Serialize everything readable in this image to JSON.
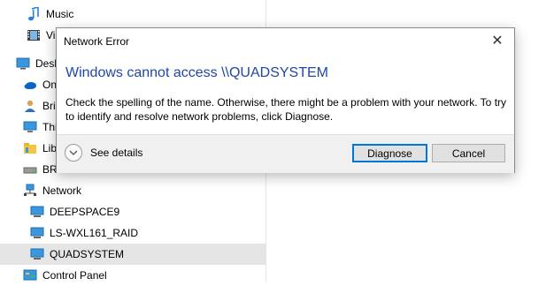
{
  "nav": {
    "items": [
      {
        "label": "Music",
        "icon": "music-note-icon"
      },
      {
        "label": "Vid",
        "icon": "videos-icon"
      },
      {
        "label": "Desk",
        "icon": "desktop-icon"
      },
      {
        "label": "On",
        "icon": "onedrive-cloud-icon"
      },
      {
        "label": "Bri",
        "icon": "user-icon"
      },
      {
        "label": "Thi",
        "icon": "this-pc-icon"
      },
      {
        "label": "Lib",
        "icon": "libraries-icon"
      },
      {
        "label": "BR",
        "icon": "drive-icon"
      },
      {
        "label": "Network",
        "icon": "network-icon"
      },
      {
        "label": "DEEPSPACE9",
        "icon": "computer-icon"
      },
      {
        "label": "LS-WXL161_RAID",
        "icon": "computer-icon"
      },
      {
        "label": "QUADSYSTEM",
        "icon": "computer-icon",
        "selected": true
      },
      {
        "label": "Control Panel",
        "icon": "control-panel-icon"
      }
    ]
  },
  "dialog": {
    "title": "Network Error",
    "heading": "Windows cannot access \\\\QUADSYSTEM",
    "message": "Check the spelling of the name. Otherwise, there might be a problem with your network. To try to identify and resolve network problems, click Diagnose.",
    "details_label": "See details",
    "diagnose_label": "Diagnose",
    "cancel_label": "Cancel",
    "close_glyph": "✕"
  },
  "colors": {
    "heading": "#1f47a8",
    "primary_border": "#0078d7",
    "selected_bg": "#e5e5e5"
  }
}
